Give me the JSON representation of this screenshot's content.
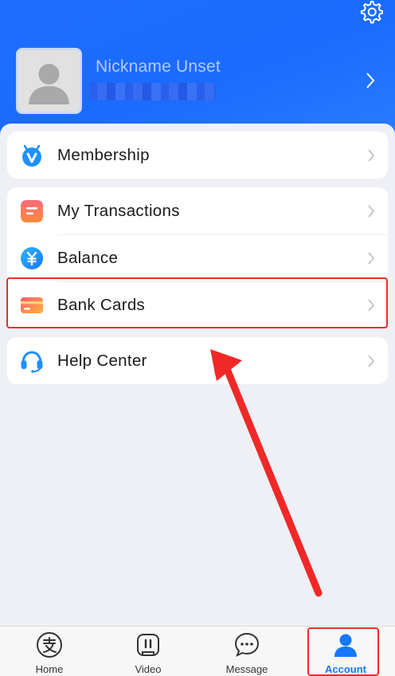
{
  "profile": {
    "nickname": "Nickname Unset"
  },
  "menu": {
    "membership": "Membership",
    "transactions": "My Transactions",
    "balance": "Balance",
    "bank_cards": "Bank Cards",
    "help_center": "Help Center"
  },
  "tabs": [
    {
      "label": "Home",
      "icon": "alipay-icon"
    },
    {
      "label": "Video",
      "icon": "video-icon"
    },
    {
      "label": "Message",
      "icon": "message-icon"
    },
    {
      "label": "Account",
      "icon": "account-icon"
    }
  ],
  "colors": {
    "header": "#1a6bff",
    "highlight": "#ef2b2b",
    "active_tab": "#1677ff"
  }
}
